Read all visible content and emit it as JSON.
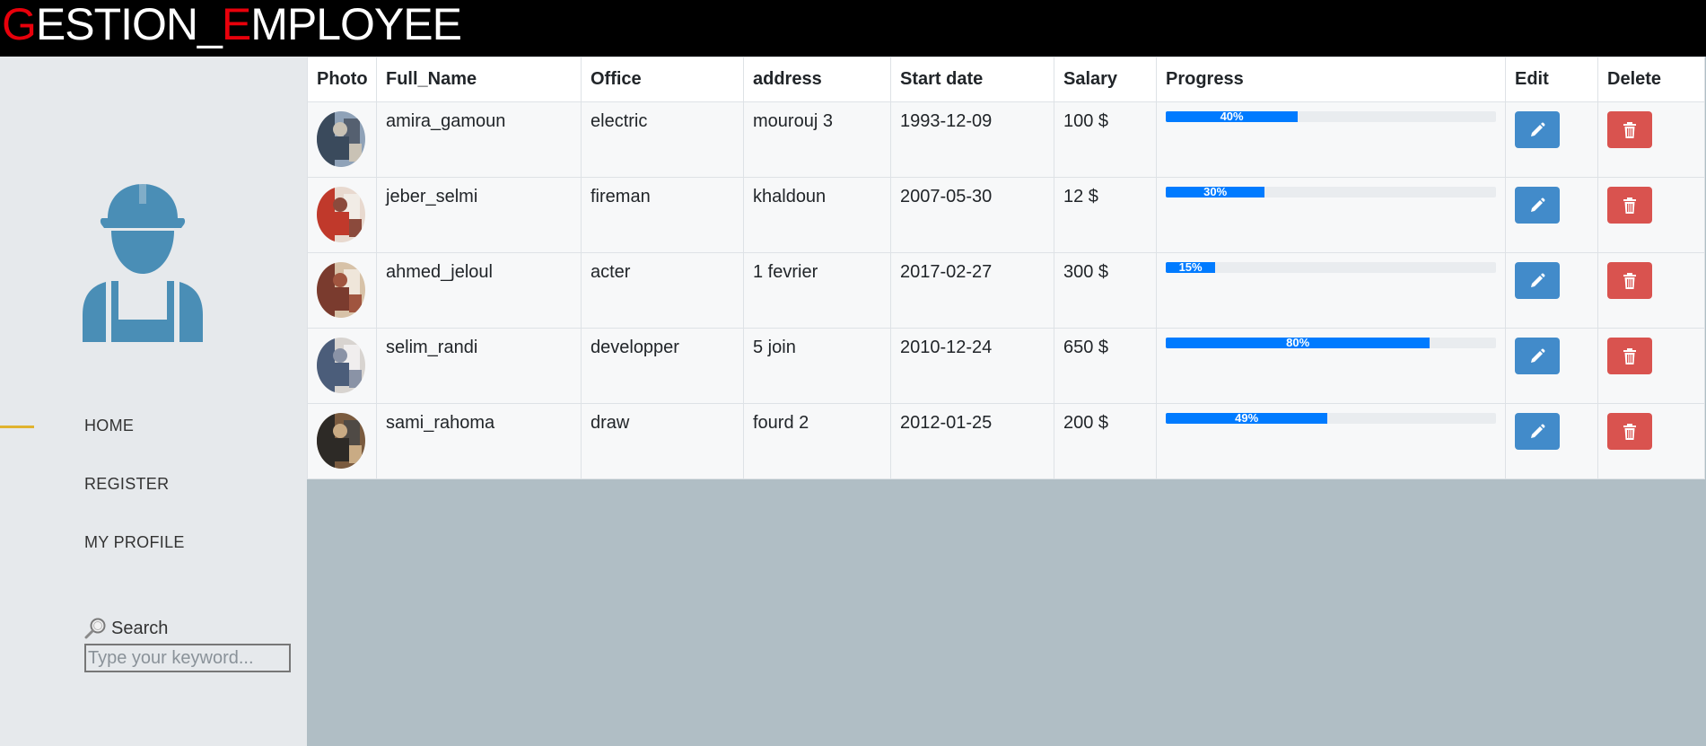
{
  "header": {
    "brand_first_letter": "G",
    "brand_part1": "ESTION_",
    "brand_second_letter": "E",
    "brand_part2": "MPLOYEE"
  },
  "sidebar": {
    "avatar_icon": "worker-helmet-icon",
    "nav": [
      {
        "label": "HOME",
        "active": true
      },
      {
        "label": "REGISTER",
        "active": false
      },
      {
        "label": "MY PROFILE",
        "active": false
      }
    ],
    "search": {
      "label": "Search",
      "icon": "magnifier-icon",
      "placeholder": "Type your keyword...",
      "value": ""
    }
  },
  "table": {
    "columns": [
      "Photo",
      "Full_Name",
      "Office",
      "address",
      "Start date",
      "Salary",
      "Progress",
      "Edit",
      "Delete"
    ],
    "rows": [
      {
        "full_name": "amira_gamoun",
        "office": "electric",
        "address": "mourouj 3",
        "start_date": "1993-12-09",
        "salary": "100 $",
        "progress": 40,
        "progress_label": "40%"
      },
      {
        "full_name": "jeber_selmi",
        "office": "fireman",
        "address": "khaldoun",
        "start_date": "2007-05-30",
        "salary": "12 $",
        "progress": 30,
        "progress_label": "30%"
      },
      {
        "full_name": "ahmed_jeloul",
        "office": "acter",
        "address": "1 fevrier",
        "start_date": "2017-02-27",
        "salary": "300 $",
        "progress": 15,
        "progress_label": "15%"
      },
      {
        "full_name": "selim_randi",
        "office": "developper",
        "address": "5 join",
        "start_date": "2010-12-24",
        "salary": "650 $",
        "progress": 80,
        "progress_label": "80%"
      },
      {
        "full_name": "sami_rahoma",
        "office": "draw",
        "address": "fourd 2",
        "start_date": "2012-01-25",
        "salary": "200 $",
        "progress": 49,
        "progress_label": "49%"
      }
    ],
    "edit_icon": "pencil-icon",
    "delete_icon": "trash-icon"
  },
  "colors": {
    "brand_accent": "#e8000b",
    "progress": "#007bff",
    "edit_button": "#428bca",
    "delete_button": "#d9534f",
    "active_nav_marker": "#e0b32f"
  }
}
